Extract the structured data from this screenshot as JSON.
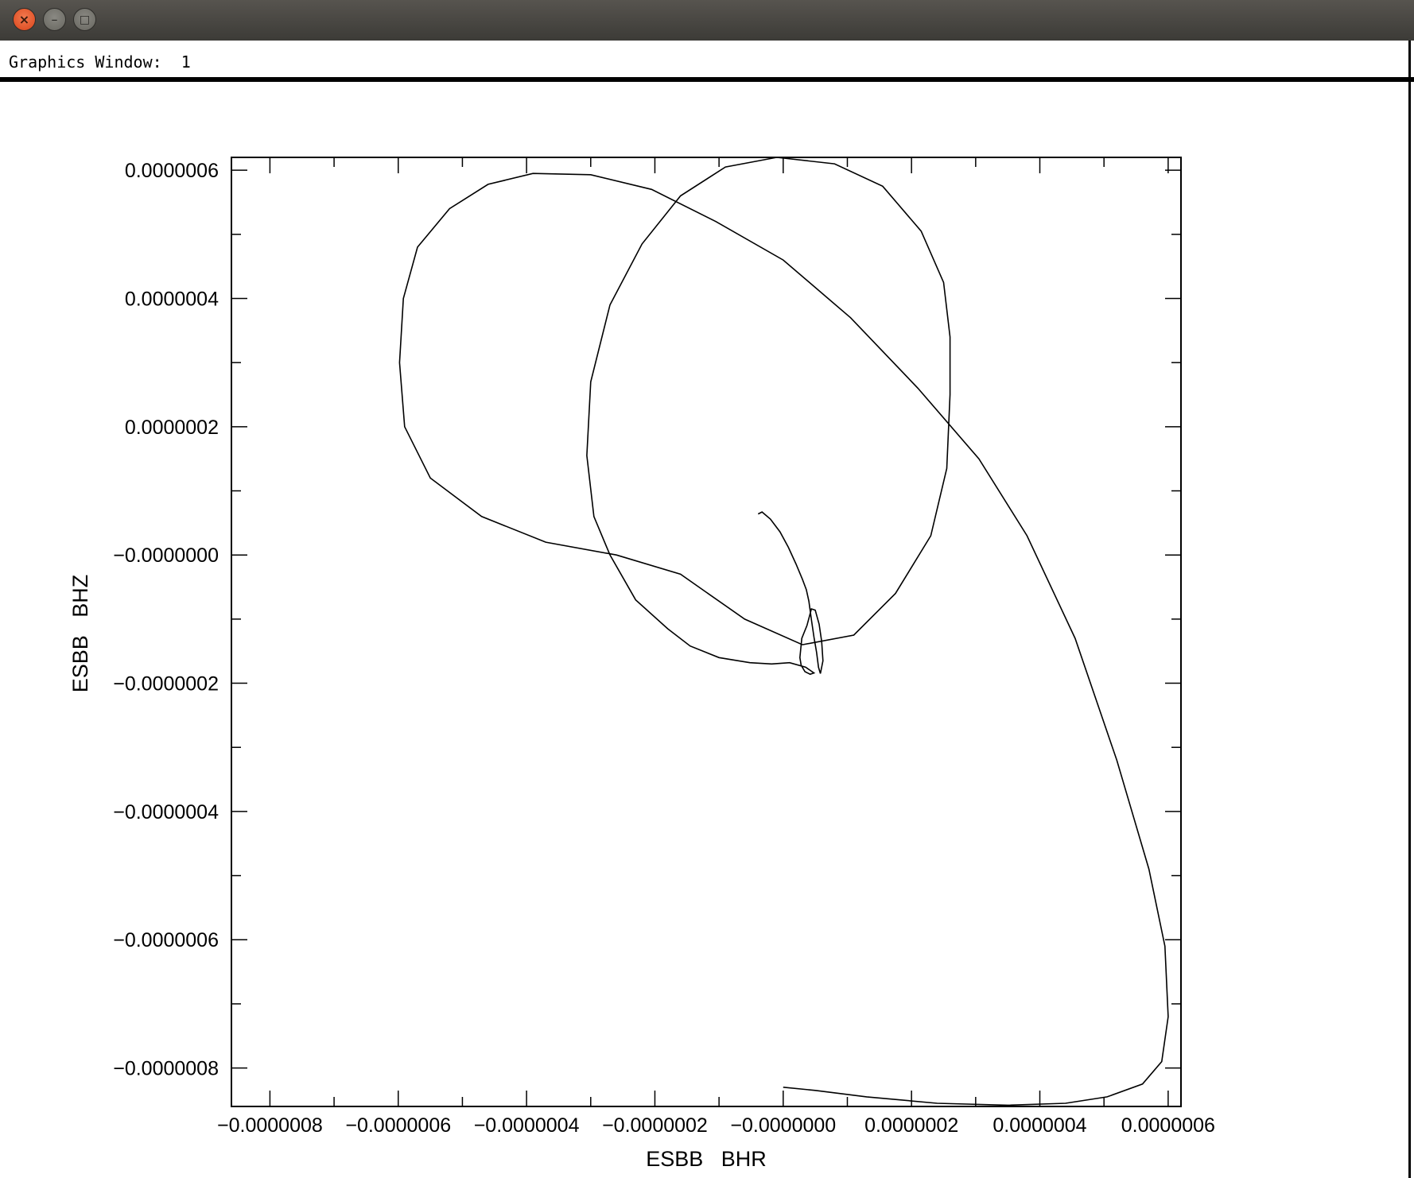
{
  "window": {
    "close_icon": "close-icon",
    "minimize_icon": "minimize-icon",
    "maximize_icon": "maximize-icon",
    "header_label": "Graphics Window:",
    "window_number": "1"
  },
  "chart_data": {
    "type": "line",
    "title": "",
    "xlabel": "ESBB   BHR",
    "ylabel": "ESBB   BHZ",
    "xlim": [
      -8.6e-07,
      6.2e-07
    ],
    "ylim": [
      -8.6e-07,
      6.2e-07
    ],
    "grid": false,
    "line_color": "#000000",
    "x_ticks": [
      -8e-07,
      -6e-07,
      -4e-07,
      -2e-07,
      0,
      2e-07,
      4e-07,
      6e-07
    ],
    "y_ticks": [
      -8e-07,
      -6e-07,
      -4e-07,
      -2e-07,
      0,
      2e-07,
      4e-07,
      6e-07
    ],
    "x_tick_labels": [
      "−0.0000008",
      "−0.0000006",
      "−0.0000004",
      "−0.0000002",
      "−0.0000000",
      "0.0000002",
      "0.0000004",
      "0.0000006"
    ],
    "y_tick_labels": [
      "−0.0000008",
      "−0.0000006",
      "−0.0000004",
      "−0.0000002",
      "−0.0000000",
      "0.0000002",
      "0.0000004",
      "0.0000006"
    ],
    "series": [
      {
        "x": [
          -3.9e-08,
          -3.3e-08,
          -2e-08,
          -5e-09,
          8e-09,
          2e-08,
          3e-08,
          3.6e-08,
          4e-08,
          4.4e-08,
          4.8e-08,
          5.2e-08,
          5.5e-08,
          5.8e-08,
          6.2e-08,
          6e-08,
          5.6e-08,
          5e-08,
          4.4e-08,
          3.7e-08,
          2.9e-08,
          2.6e-08,
          2.8e-08,
          3.4e-08,
          4.2e-08,
          4.8e-08,
          3.5e-08,
          1e-08,
          -1.8e-08,
          -5.2e-08,
          -1e-07,
          -1.45e-07,
          -1.8e-07,
          -2.3e-07,
          -2.7e-07,
          -2.95e-07,
          -3.06e-07,
          -3e-07,
          -2.7e-07,
          -2.2e-07,
          -1.6e-07,
          -9e-08,
          -1e-08,
          8e-08,
          1.55e-07,
          2.15e-07,
          2.5e-07,
          2.6e-07,
          2.6e-07,
          2.55e-07,
          2.3e-07,
          1.75e-07,
          1.1e-07,
          3e-08,
          -6e-08,
          -1.6e-07,
          -2.6e-07,
          -3.7e-07,
          -4.7e-07,
          -5.5e-07,
          -5.9e-07,
          -5.98e-07,
          -5.92e-07,
          -5.7e-07,
          -5.2e-07,
          -4.6e-07,
          -3.9e-07,
          -3e-07,
          -2.05e-07,
          -1.05e-07,
          0.0,
          1.05e-07,
          2.1e-07,
          3.05e-07,
          3.8e-07,
          4.55e-07,
          5.2e-07,
          5.7e-07,
          5.95e-07,
          6e-07,
          5.9e-07,
          5.6e-07,
          5.05e-07,
          4.4e-07,
          3.5e-07,
          2.4e-07,
          1.3e-07,
          5e-08,
          0.0
        ],
        "y": [
          6.4e-08,
          6.7e-08,
          5.6e-08,
          3.6e-08,
          1.2e-08,
          -1.4e-08,
          -3.8e-08,
          -5.4e-08,
          -7.2e-08,
          -1.01e-07,
          -1.28e-07,
          -1.52e-07,
          -1.75e-07,
          -1.85e-07,
          -1.65e-07,
          -1.35e-07,
          -1.08e-07,
          -8.6e-08,
          -8.4e-08,
          -1.1e-07,
          -1.3e-07,
          -1.6e-07,
          -1.72e-07,
          -1.82e-07,
          -1.86e-07,
          -1.84e-07,
          -1.75e-07,
          -1.68e-07,
          -1.7e-07,
          -1.68e-07,
          -1.6e-07,
          -1.42e-07,
          -1.15e-07,
          -7e-08,
          0.0,
          6e-08,
          1.55e-07,
          2.7e-07,
          3.9e-07,
          4.85e-07,
          5.6e-07,
          6.05e-07,
          6.2e-07,
          6.1e-07,
          5.75e-07,
          5.05e-07,
          4.25e-07,
          3.4e-07,
          2.5e-07,
          1.35e-07,
          3e-08,
          -6e-08,
          -1.25e-07,
          -1.4e-07,
          -1e-07,
          -3e-08,
          0.0,
          2e-08,
          6e-08,
          1.2e-07,
          2e-07,
          3e-07,
          4e-07,
          4.8e-07,
          5.4e-07,
          5.78e-07,
          5.95e-07,
          5.93e-07,
          5.7e-07,
          5.2e-07,
          4.6e-07,
          3.7e-07,
          2.6e-07,
          1.5e-07,
          3e-08,
          -1.3e-07,
          -3.2e-07,
          -4.9e-07,
          -6.1e-07,
          -7.2e-07,
          -7.9e-07,
          -8.25e-07,
          -8.45e-07,
          -8.55e-07,
          -8.58e-07,
          -8.55e-07,
          -8.45e-07,
          -8.35e-07,
          -8.3e-07
        ]
      }
    ]
  }
}
